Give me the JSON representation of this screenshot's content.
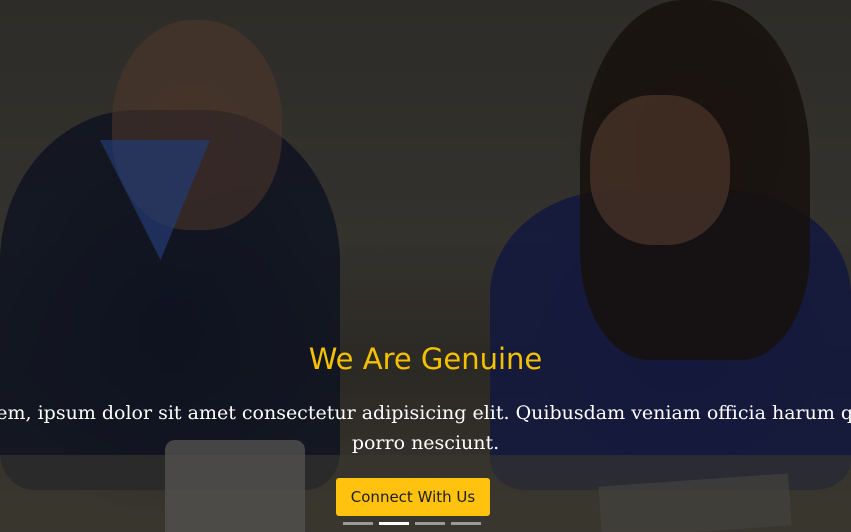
{
  "hero": {
    "title": "We Are Genuine",
    "description": "Lorem, ipsum dolor sit amet consectetur adipisicing elit. Quibusdam veniam officia harum quae porro nesciunt.",
    "cta_label": "Connect With Us",
    "background_image": "two people smiling at a desk",
    "accent_color": "#ffc20e",
    "title_color": "#f5c000"
  },
  "carousel": {
    "indicators": [
      {
        "label": "slide-1",
        "active": false
      },
      {
        "label": "slide-2",
        "active": true
      },
      {
        "label": "slide-3",
        "active": false
      },
      {
        "label": "slide-4",
        "active": false
      }
    ]
  }
}
